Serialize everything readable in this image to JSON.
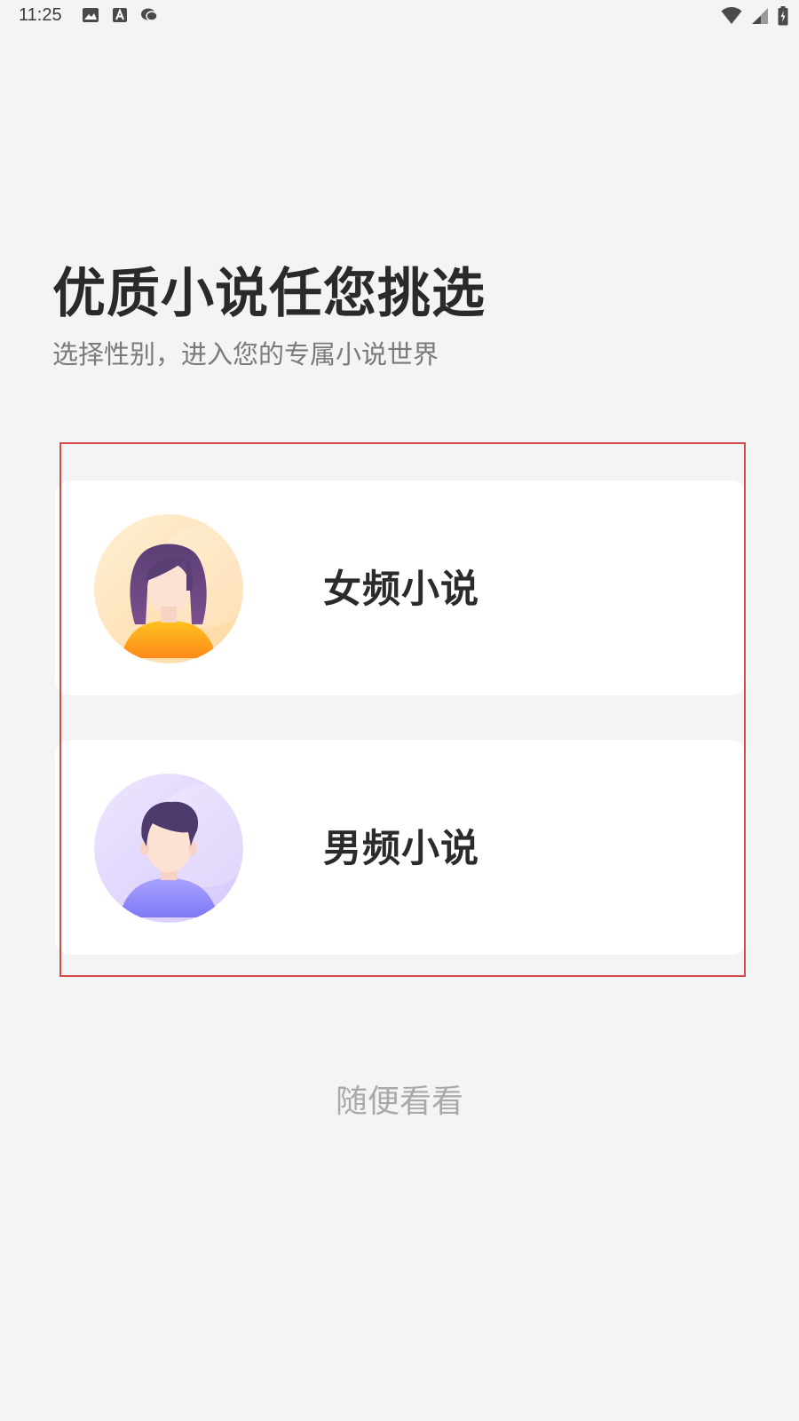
{
  "status_bar": {
    "time": "11:25",
    "left_icons": [
      "image-icon",
      "text-a-icon",
      "chat-icon"
    ],
    "right_icons": [
      "wifi-icon",
      "signal-icon",
      "battery-icon"
    ]
  },
  "header": {
    "title": "优质小说任您挑选",
    "subtitle": "选择性别，进入您的专属小说世界"
  },
  "options": [
    {
      "label": "女频小说",
      "avatar": "female-avatar-icon",
      "avatar_bg": "#fde3b8",
      "accent": "#ff9a1f"
    },
    {
      "label": "男频小说",
      "avatar": "male-avatar-icon",
      "avatar_bg": "#e2d6fb",
      "accent": "#8f86ff"
    }
  ],
  "browse": {
    "label": "随便看看"
  },
  "colors": {
    "background": "#f3f4f6",
    "frame_border": "#d84a4a",
    "title": "#2a2a2a",
    "subtitle": "#7a7a7a",
    "browse_text": "#a9a9a9"
  }
}
